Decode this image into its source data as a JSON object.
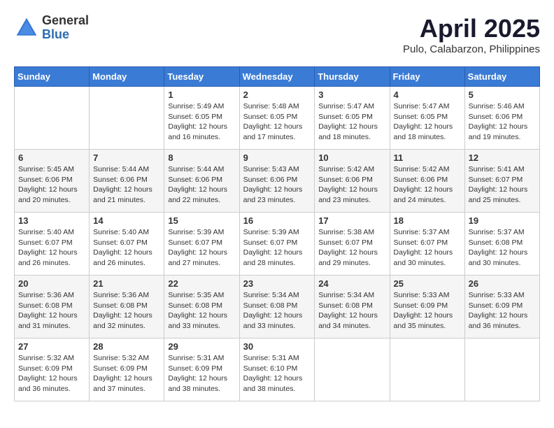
{
  "header": {
    "logo_general": "General",
    "logo_blue": "Blue",
    "month_title": "April 2025",
    "location": "Pulo, Calabarzon, Philippines"
  },
  "days_of_week": [
    "Sunday",
    "Monday",
    "Tuesday",
    "Wednesday",
    "Thursday",
    "Friday",
    "Saturday"
  ],
  "weeks": [
    [
      {
        "day": "",
        "detail": ""
      },
      {
        "day": "",
        "detail": ""
      },
      {
        "day": "1",
        "sunrise": "Sunrise: 5:49 AM",
        "sunset": "Sunset: 6:05 PM",
        "daylight": "Daylight: 12 hours and 16 minutes."
      },
      {
        "day": "2",
        "sunrise": "Sunrise: 5:48 AM",
        "sunset": "Sunset: 6:05 PM",
        "daylight": "Daylight: 12 hours and 17 minutes."
      },
      {
        "day": "3",
        "sunrise": "Sunrise: 5:47 AM",
        "sunset": "Sunset: 6:05 PM",
        "daylight": "Daylight: 12 hours and 18 minutes."
      },
      {
        "day": "4",
        "sunrise": "Sunrise: 5:47 AM",
        "sunset": "Sunset: 6:05 PM",
        "daylight": "Daylight: 12 hours and 18 minutes."
      },
      {
        "day": "5",
        "sunrise": "Sunrise: 5:46 AM",
        "sunset": "Sunset: 6:06 PM",
        "daylight": "Daylight: 12 hours and 19 minutes."
      }
    ],
    [
      {
        "day": "6",
        "sunrise": "Sunrise: 5:45 AM",
        "sunset": "Sunset: 6:06 PM",
        "daylight": "Daylight: 12 hours and 20 minutes."
      },
      {
        "day": "7",
        "sunrise": "Sunrise: 5:44 AM",
        "sunset": "Sunset: 6:06 PM",
        "daylight": "Daylight: 12 hours and 21 minutes."
      },
      {
        "day": "8",
        "sunrise": "Sunrise: 5:44 AM",
        "sunset": "Sunset: 6:06 PM",
        "daylight": "Daylight: 12 hours and 22 minutes."
      },
      {
        "day": "9",
        "sunrise": "Sunrise: 5:43 AM",
        "sunset": "Sunset: 6:06 PM",
        "daylight": "Daylight: 12 hours and 23 minutes."
      },
      {
        "day": "10",
        "sunrise": "Sunrise: 5:42 AM",
        "sunset": "Sunset: 6:06 PM",
        "daylight": "Daylight: 12 hours and 23 minutes."
      },
      {
        "day": "11",
        "sunrise": "Sunrise: 5:42 AM",
        "sunset": "Sunset: 6:06 PM",
        "daylight": "Daylight: 12 hours and 24 minutes."
      },
      {
        "day": "12",
        "sunrise": "Sunrise: 5:41 AM",
        "sunset": "Sunset: 6:07 PM",
        "daylight": "Daylight: 12 hours and 25 minutes."
      }
    ],
    [
      {
        "day": "13",
        "sunrise": "Sunrise: 5:40 AM",
        "sunset": "Sunset: 6:07 PM",
        "daylight": "Daylight: 12 hours and 26 minutes."
      },
      {
        "day": "14",
        "sunrise": "Sunrise: 5:40 AM",
        "sunset": "Sunset: 6:07 PM",
        "daylight": "Daylight: 12 hours and 26 minutes."
      },
      {
        "day": "15",
        "sunrise": "Sunrise: 5:39 AM",
        "sunset": "Sunset: 6:07 PM",
        "daylight": "Daylight: 12 hours and 27 minutes."
      },
      {
        "day": "16",
        "sunrise": "Sunrise: 5:39 AM",
        "sunset": "Sunset: 6:07 PM",
        "daylight": "Daylight: 12 hours and 28 minutes."
      },
      {
        "day": "17",
        "sunrise": "Sunrise: 5:38 AM",
        "sunset": "Sunset: 6:07 PM",
        "daylight": "Daylight: 12 hours and 29 minutes."
      },
      {
        "day": "18",
        "sunrise": "Sunrise: 5:37 AM",
        "sunset": "Sunset: 6:07 PM",
        "daylight": "Daylight: 12 hours and 30 minutes."
      },
      {
        "day": "19",
        "sunrise": "Sunrise: 5:37 AM",
        "sunset": "Sunset: 6:08 PM",
        "daylight": "Daylight: 12 hours and 30 minutes."
      }
    ],
    [
      {
        "day": "20",
        "sunrise": "Sunrise: 5:36 AM",
        "sunset": "Sunset: 6:08 PM",
        "daylight": "Daylight: 12 hours and 31 minutes."
      },
      {
        "day": "21",
        "sunrise": "Sunrise: 5:36 AM",
        "sunset": "Sunset: 6:08 PM",
        "daylight": "Daylight: 12 hours and 32 minutes."
      },
      {
        "day": "22",
        "sunrise": "Sunrise: 5:35 AM",
        "sunset": "Sunset: 6:08 PM",
        "daylight": "Daylight: 12 hours and 33 minutes."
      },
      {
        "day": "23",
        "sunrise": "Sunrise: 5:34 AM",
        "sunset": "Sunset: 6:08 PM",
        "daylight": "Daylight: 12 hours and 33 minutes."
      },
      {
        "day": "24",
        "sunrise": "Sunrise: 5:34 AM",
        "sunset": "Sunset: 6:08 PM",
        "daylight": "Daylight: 12 hours and 34 minutes."
      },
      {
        "day": "25",
        "sunrise": "Sunrise: 5:33 AM",
        "sunset": "Sunset: 6:09 PM",
        "daylight": "Daylight: 12 hours and 35 minutes."
      },
      {
        "day": "26",
        "sunrise": "Sunrise: 5:33 AM",
        "sunset": "Sunset: 6:09 PM",
        "daylight": "Daylight: 12 hours and 36 minutes."
      }
    ],
    [
      {
        "day": "27",
        "sunrise": "Sunrise: 5:32 AM",
        "sunset": "Sunset: 6:09 PM",
        "daylight": "Daylight: 12 hours and 36 minutes."
      },
      {
        "day": "28",
        "sunrise": "Sunrise: 5:32 AM",
        "sunset": "Sunset: 6:09 PM",
        "daylight": "Daylight: 12 hours and 37 minutes."
      },
      {
        "day": "29",
        "sunrise": "Sunrise: 5:31 AM",
        "sunset": "Sunset: 6:09 PM",
        "daylight": "Daylight: 12 hours and 38 minutes."
      },
      {
        "day": "30",
        "sunrise": "Sunrise: 5:31 AM",
        "sunset": "Sunset: 6:10 PM",
        "daylight": "Daylight: 12 hours and 38 minutes."
      },
      {
        "day": "",
        "detail": ""
      },
      {
        "day": "",
        "detail": ""
      },
      {
        "day": "",
        "detail": ""
      }
    ]
  ]
}
